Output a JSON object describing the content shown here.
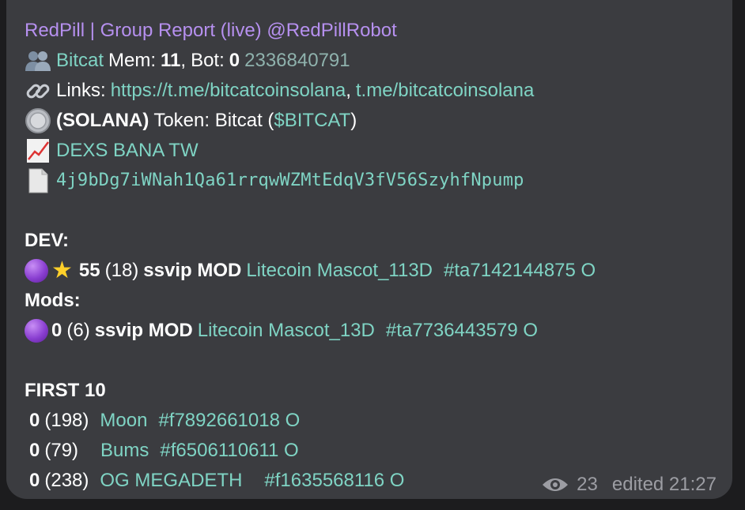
{
  "message": {
    "sender": "RedPill | Group Report (live) @RedPillRobot",
    "group": {
      "name": "Bitcat",
      "mem_label": "Mem:",
      "mem_value": "11",
      "bot_label": "Bot:",
      "bot_value": "0",
      "id": "2336840791"
    },
    "links": {
      "label": "Links:",
      "link1": "https://t.me/bitcatcoinsolana",
      "sep": ",",
      "link2": "t.me/bitcatcoinsolana"
    },
    "token": {
      "chain": "(SOLANA)",
      "label": "Token: Bitcat (",
      "ticker": "$BITCAT",
      "close": ")"
    },
    "dex_links": "DEXS BANA TW",
    "contract": "4j9bDg7iWNah1Qa61rrqwWZMtEdqV3fV56SzyhfNpump",
    "dev": {
      "heading": "DEV:",
      "score": "55",
      "count": "(18)",
      "tags": "ssvip MOD",
      "name": "Litecoin Mascot_113D",
      "id": "#ta7142144875 O"
    },
    "mods": {
      "heading": "Mods:",
      "score": "0",
      "count": "(6)",
      "tags": "ssvip MOD",
      "name": "Litecoin Mascot_13D",
      "id": "#ta7736443579 O"
    },
    "first10": {
      "heading": "FIRST 10",
      "rows": [
        {
          "score": "0",
          "count": "(198)",
          "name": "Moon",
          "id": "#f7892661018 O"
        },
        {
          "score": "0",
          "count": "(79)",
          "name": "Bums",
          "id": "#f6506110611 O"
        },
        {
          "score": "0",
          "count": "(238)",
          "name": "OG MEGADETH",
          "id": "#f1635568116 O"
        }
      ]
    },
    "views": "23",
    "edited": "edited 21:27"
  },
  "icons": {
    "members": "busts-in-silhouette-icon",
    "links": "link-icon",
    "coin": "coin-icon",
    "chart": "chart-increasing-icon",
    "document": "page-icon",
    "purple": "purple-circle-icon",
    "star": "star-icon",
    "views": "eye-icon"
  }
}
